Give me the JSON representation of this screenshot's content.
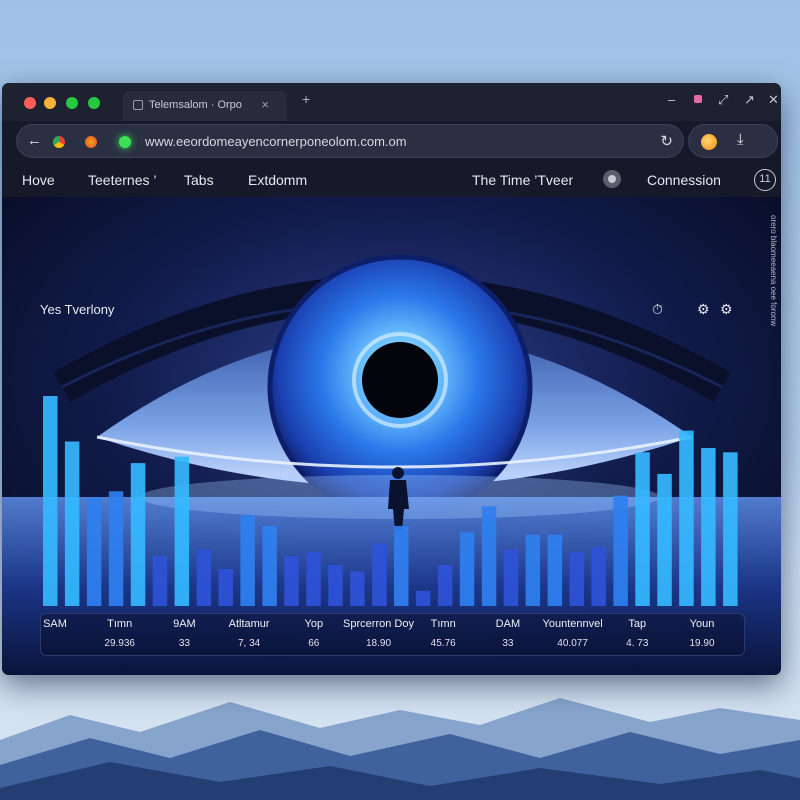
{
  "browser": {
    "tab_title": "Telemsalom · Orpo",
    "tab_close": "×",
    "new_tab": "+",
    "url": "www.eeordomeayencornerponeolom.com.om",
    "controls": {
      "minimize": "–",
      "maximize": "⤢",
      "close": "✕"
    },
    "back": "←",
    "reload": "↻",
    "ext_icon": "⤓"
  },
  "nav": {
    "items": [
      "Hove",
      "Teeternes ’",
      "Tabs",
      "Extdomm"
    ],
    "right_label": "The Time ’Tveer",
    "right_action": "Connession",
    "info": "11"
  },
  "content": {
    "title": "Yes Tverlony",
    "icons": {
      "timer": "⏱",
      "settings": "⚙"
    },
    "side_text": "orero blaomeeaena oee foronw"
  },
  "chart_data": {
    "type": "bar",
    "values": [
      9.7,
      7.6,
      5.0,
      5.3,
      6.6,
      2.3,
      6.9,
      2.6,
      1.7,
      4.2,
      3.7,
      2.3,
      2.5,
      1.9,
      1.6,
      2.9,
      3.7,
      0.7,
      1.9,
      3.4,
      4.6,
      2.6,
      3.3,
      3.3,
      2.5,
      2.7,
      5.1,
      7.1,
      6.1,
      8.1,
      7.3,
      7.1
    ],
    "x_labels": [
      {
        "top": "SAM",
        "bottom": ""
      },
      {
        "top": "Tımn",
        "bottom": "29.936"
      },
      {
        "top": "9AM",
        "bottom": "33"
      },
      {
        "top": "Atltamur",
        "bottom": "7, 34"
      },
      {
        "top": "Yop",
        "bottom": "66"
      },
      {
        "top": "Sprcerron Doy",
        "bottom": "18.90"
      },
      {
        "top": "Tımn",
        "bottom": "45.76"
      },
      {
        "top": "DAM",
        "bottom": "33"
      },
      {
        "top": "Yountennvel",
        "bottom": "40.077"
      },
      {
        "top": "Tap",
        "bottom": "4. 73"
      },
      {
        "top": "Youn",
        "bottom": "19.90"
      }
    ],
    "colors": {
      "bright": "#35b8ff",
      "mid": "#2f7ff0",
      "deep": "#2f52d8"
    }
  }
}
